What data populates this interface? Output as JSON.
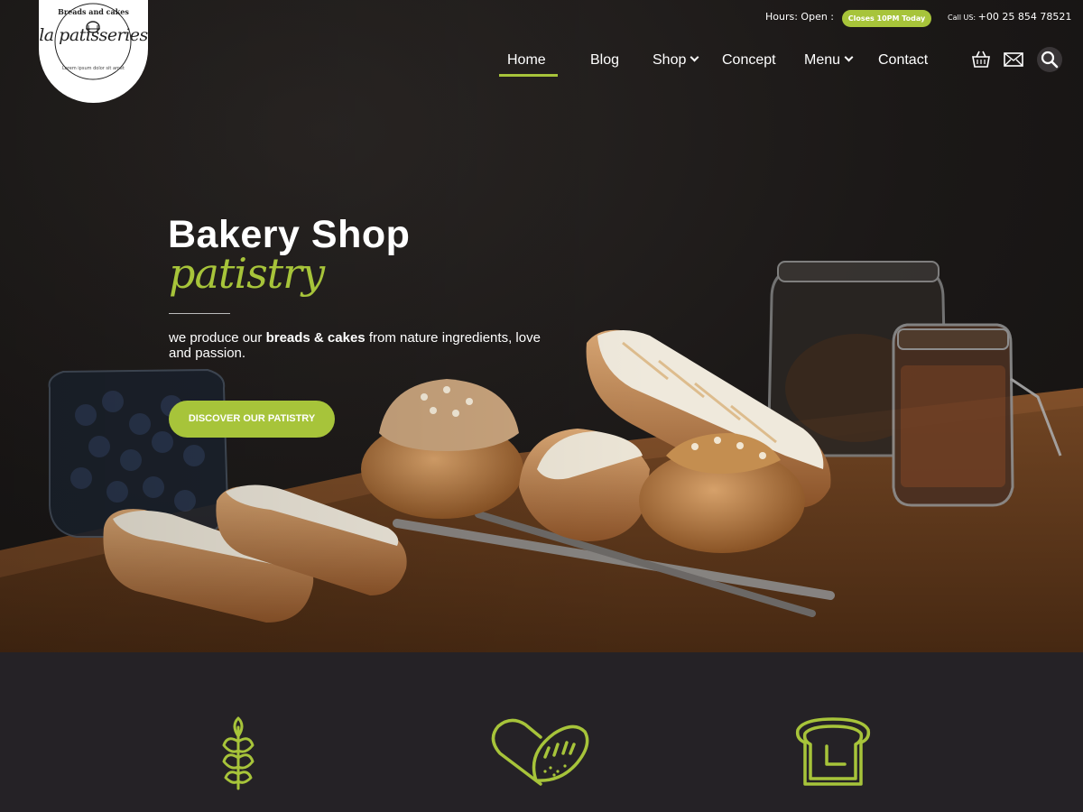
{
  "logo": {
    "top_text": "Breads and cakes",
    "name": "la patisseries",
    "tagline": "Lorem ipsum dolor sit amet"
  },
  "topbar": {
    "hours_label": "Hours: Open :",
    "hours_badge": "Closes 10PM Today",
    "call_label": "Call US:",
    "call_number": "+00 25 854 78521"
  },
  "nav": {
    "items": [
      {
        "label": "Home",
        "active": true
      },
      {
        "label": "Blog"
      },
      {
        "label": "Shop",
        "has_dropdown": true
      },
      {
        "label": "Concept"
      },
      {
        "label": "Menu",
        "has_dropdown": true
      },
      {
        "label": "Contact"
      }
    ],
    "icons": [
      "basket-icon",
      "mail-icon",
      "search-icon"
    ]
  },
  "hero": {
    "title": "Bakery Shop",
    "script": "patistry",
    "desc_pre": "we produce our ",
    "desc_bold": "breads & cakes",
    "desc_post": " from nature ingredients, love and passion.",
    "cta": "DISCOVER OUR PATISTRY"
  },
  "features": {
    "icons": [
      "wheat-icon",
      "bread-heart-icon",
      "toast-clock-icon"
    ]
  },
  "colors": {
    "accent": "#a7c43a",
    "background": "#252226"
  }
}
